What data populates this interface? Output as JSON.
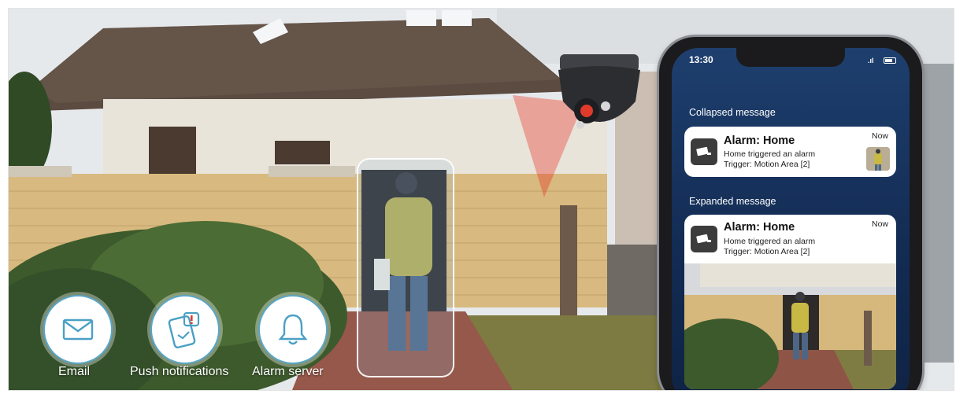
{
  "features": [
    {
      "label": "Email",
      "icon": "email-icon"
    },
    {
      "label": "Push notifications",
      "icon": "push-notification-icon"
    },
    {
      "label": "Alarm server",
      "icon": "bell-icon"
    }
  ],
  "phone": {
    "status_time": "13:30",
    "collapsed_heading": "Collapsed message",
    "expanded_heading": "Expanded message",
    "collapsed_card": {
      "title": "Alarm: Home",
      "line1": "Home triggered an alarm",
      "line2": "Trigger: Motion Area [2]",
      "time": "Now"
    },
    "expanded_card": {
      "title": "Alarm: Home",
      "line1": "Home triggered an alarm",
      "line2": "Trigger: Motion Area [2]",
      "time": "Now"
    }
  },
  "colors": {
    "accent": "#5aa6c8",
    "phone_screen": "#1e3f6e",
    "detection_beam": "#e8281e"
  }
}
